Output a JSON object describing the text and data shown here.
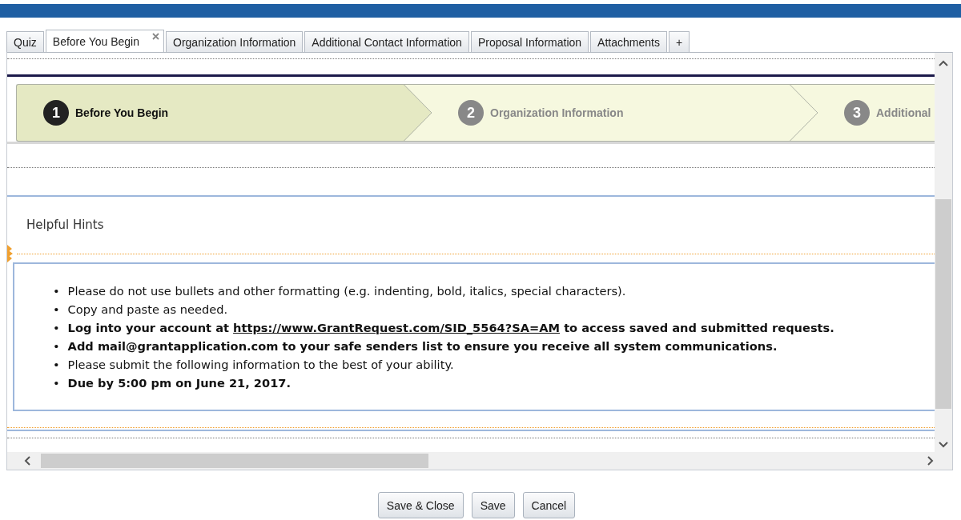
{
  "tabs": [
    {
      "label": "Quiz",
      "selected": false,
      "closable": false
    },
    {
      "label": "Before You Begin",
      "selected": true,
      "closable": true
    },
    {
      "label": "Organization Information",
      "selected": false,
      "closable": false
    },
    {
      "label": "Additional Contact Information",
      "selected": false,
      "closable": false
    },
    {
      "label": "Proposal Information",
      "selected": false,
      "closable": false
    },
    {
      "label": "Attachments",
      "selected": false,
      "closable": false
    },
    {
      "label": "+",
      "selected": false,
      "closable": false
    }
  ],
  "steps": [
    {
      "number": "1",
      "label": "Before You Begin",
      "selected": true
    },
    {
      "number": "2",
      "label": "Organization Information",
      "selected": false
    },
    {
      "number": "3",
      "label": "Additional",
      "selected": false
    }
  ],
  "section_title": "Helpful Hints",
  "hints": [
    {
      "bullet": "•",
      "text": "Please do not use bullets and other formatting (e.g. indenting, bold, italics, special characters).",
      "bold": false
    },
    {
      "bullet": "•",
      "text": "Copy and paste as needed.",
      "bold": false
    },
    {
      "bullet": "•",
      "text": "Log into your account at ",
      "link": "https://www.GrantRequest.com/SID_5564?SA=AM",
      "text_after": " to access saved and submitted requests.",
      "bold": true
    },
    {
      "bullet": "•",
      "text": "Add mail@grantapplication.com to your safe senders list to ensure you receive all system communications.",
      "bold": true
    },
    {
      "bullet": "•",
      "text": "Please submit the following information to the best of your ability.",
      "bold": false
    },
    {
      "bullet": "•",
      "text": "Due by 5:00 pm on June 21, 2017.",
      "bold": true
    }
  ],
  "buttons": [
    "Save & Close",
    "Save",
    "Cancel"
  ]
}
